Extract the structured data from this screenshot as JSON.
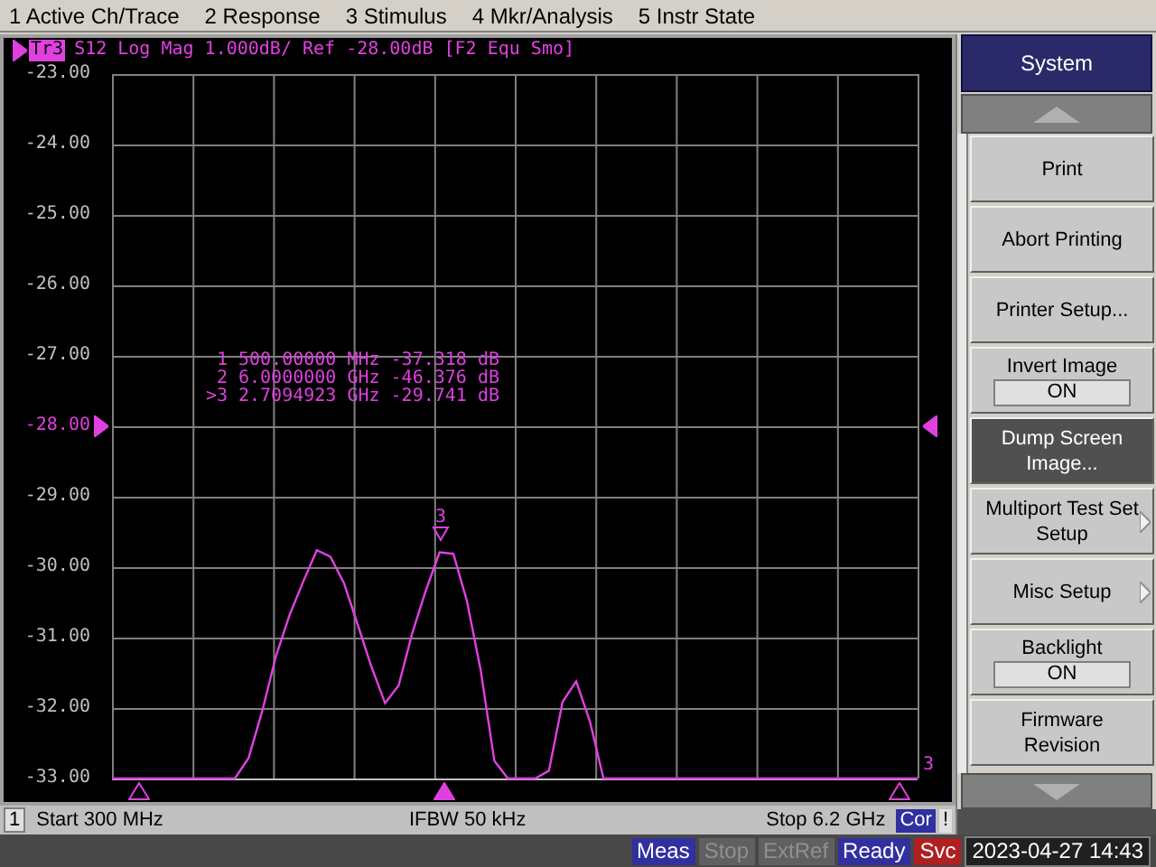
{
  "menu": [
    "1 Active Ch/Trace",
    "2 Response",
    "3 Stimulus",
    "4 Mkr/Analysis",
    "5 Instr State"
  ],
  "trace_header": {
    "badge": "Tr3",
    "title": "S12 Log Mag 1.000dB/ Ref -28.00dB [F2 Equ Smo]"
  },
  "y_labels": [
    {
      "reference": false
    },
    {
      "reference": false
    },
    {
      "reference": false
    },
    {
      "reference": false
    },
    {
      "reference": false
    },
    {
      "reference": true
    },
    {
      "reference": false
    },
    {
      "reference": false
    },
    {
      "reference": false
    },
    {
      "reference": false
    },
    {
      "reference": false
    }
  ],
  "chart_data": {
    "type": "line",
    "ylim": [
      -33,
      -23
    ],
    "grid": true,
    "yticks": [
      {
        "value": -23,
        "label": "-23.00"
      },
      {
        "value": -24,
        "label": "-24.00"
      },
      {
        "value": -25,
        "label": "-25.00"
      },
      {
        "value": -26,
        "label": "-26.00"
      },
      {
        "value": -27,
        "label": "-27.00"
      },
      {
        "value": -28,
        "label": "-28.00"
      },
      {
        "value": -29,
        "label": "-29.00"
      },
      {
        "value": -30,
        "label": "-30.00"
      },
      {
        "value": -31,
        "label": "-31.00"
      },
      {
        "value": -32,
        "label": "-32.00"
      },
      {
        "value": -33,
        "label": "-33.00"
      }
    ],
    "categories": [
      null,
      null,
      null,
      null,
      null,
      null,
      null,
      null,
      null,
      null,
      null,
      null,
      null,
      null,
      null,
      null,
      null,
      null,
      null,
      null,
      null,
      null,
      null,
      null,
      null,
      null,
      null,
      null,
      null,
      null,
      null,
      null,
      null,
      null,
      null,
      null,
      null,
      null,
      null,
      null,
      null,
      null,
      null,
      null,
      null,
      null,
      null,
      null,
      null,
      null,
      null,
      null,
      null,
      null,
      null,
      null,
      null,
      null,
      null,
      null
    ],
    "series": [
      {
        "color": "#e040e0",
        "values": [
          -33,
          -33,
          -33,
          -33,
          -33,
          -33,
          -33,
          -33,
          -33,
          -33,
          -32.71,
          -32.04,
          -31.27,
          -30.68,
          -30.21,
          -29.76,
          -29.85,
          -30.23,
          -30.82,
          -31.41,
          -31.93,
          -31.68,
          -30.93,
          -30.32,
          -29.79,
          -29.81,
          -30.48,
          -31.46,
          -32.75,
          -33,
          -33,
          -33,
          -32.89,
          -31.91,
          -31.62,
          -32.19,
          -33,
          -33,
          -33,
          -33,
          -33,
          -33,
          -33,
          -33,
          -33,
          -33,
          -33,
          -33,
          -33,
          -33,
          -33,
          -33,
          -33,
          -33,
          -33,
          -33,
          -33,
          -33,
          -33,
          -33
        ]
      }
    ]
  },
  "markers": [
    {
      "label": "1",
      "frequency": "500.00000 MHz",
      "value": "-37.318 dB",
      "active": false
    },
    {
      "label": "2",
      "frequency": "6.0000000 GHz",
      "value": "-46.376 dB",
      "active": false
    },
    {
      "label": ">3",
      "frequency": "2.7094923 GHz",
      "value": "-29.741 dB",
      "active": true
    }
  ],
  "trace_marker_label": "3",
  "trace_end_label": "3",
  "channel_status": {
    "channel": "1",
    "start": "Start 300 MHz",
    "ifbw": "IFBW 50 kHz",
    "stop": "Stop 6.2 GHz",
    "correction": "Cor",
    "warning": "!"
  },
  "softkey_panel": {
    "title": "System",
    "keys": [
      {
        "kind": "action",
        "label": "Print",
        "selected": false
      },
      {
        "kind": "action",
        "label": "Abort Printing",
        "selected": false
      },
      {
        "kind": "action",
        "label": "Printer Setup...",
        "selected": false
      },
      {
        "kind": "toggle",
        "label": "Invert Image",
        "value": "ON",
        "selected": false
      },
      {
        "kind": "action",
        "label": "Dump Screen Image...",
        "selected": true
      },
      {
        "kind": "submenu",
        "label": "Multiport Test Set Setup",
        "selected": false
      },
      {
        "kind": "submenu",
        "label": "Misc Setup",
        "selected": false
      },
      {
        "kind": "toggle",
        "label": "Backlight",
        "value": "ON",
        "selected": false
      },
      {
        "kind": "action",
        "label": "Firmware Revision",
        "selected": false
      }
    ]
  },
  "status_bar": {
    "indicators": [
      {
        "text": "Meas",
        "kind": "active"
      },
      {
        "text": "Stop",
        "kind": "disabled"
      },
      {
        "text": "ExtRef",
        "kind": "disabled"
      },
      {
        "text": "Ready",
        "kind": "active"
      },
      {
        "text": "Svc",
        "kind": "alert"
      }
    ],
    "datetime": "2023-04-27 14:43"
  }
}
